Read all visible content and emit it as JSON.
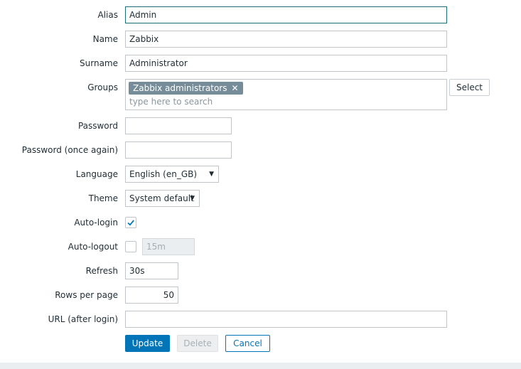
{
  "form": {
    "alias": {
      "label": "Alias",
      "value": "Admin"
    },
    "name": {
      "label": "Name",
      "value": "Zabbix"
    },
    "surname": {
      "label": "Surname",
      "value": "Administrator"
    },
    "groups": {
      "label": "Groups",
      "chips": [
        "Zabbix administrators"
      ],
      "placeholder": "type here to search",
      "select_label": "Select"
    },
    "password": {
      "label": "Password",
      "value": ""
    },
    "password_again": {
      "label": "Password (once again)",
      "value": ""
    },
    "language": {
      "label": "Language",
      "value": "English (en_GB)"
    },
    "theme": {
      "label": "Theme",
      "value": "System default"
    },
    "autologin": {
      "label": "Auto-login",
      "checked": true
    },
    "autologout": {
      "label": "Auto-logout",
      "checked": false,
      "value": "15m"
    },
    "refresh": {
      "label": "Refresh",
      "value": "30s"
    },
    "rows_per_page": {
      "label": "Rows per page",
      "value": "50"
    },
    "url": {
      "label": "URL (after login)",
      "value": ""
    }
  },
  "buttons": {
    "update": "Update",
    "delete": "Delete",
    "cancel": "Cancel"
  },
  "icons": {
    "chip_remove": "close-icon",
    "select_arrow": "caret-down-icon",
    "check": "checkmark-icon"
  },
  "colors": {
    "primary": "#0275b8",
    "chip": "#768d99",
    "focus_border": "#1b6f7a"
  }
}
